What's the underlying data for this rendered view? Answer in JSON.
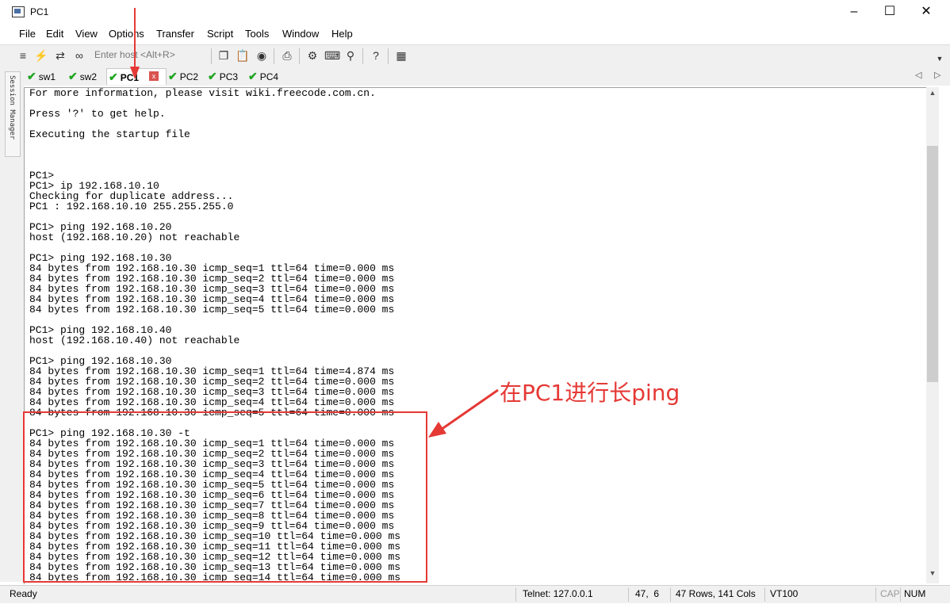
{
  "window": {
    "title": "PC1"
  },
  "menu": [
    "File",
    "Edit",
    "View",
    "Options",
    "Transfer",
    "Script",
    "Tools",
    "Window",
    "Help"
  ],
  "toolbar": {
    "host_placeholder": "Enter host <Alt+R>"
  },
  "tabs": [
    {
      "label": "sw1",
      "status": "connected"
    },
    {
      "label": "sw2",
      "status": "connected"
    },
    {
      "label": "PC1",
      "status": "connected",
      "active": true
    },
    {
      "label": "PC2",
      "status": "connected"
    },
    {
      "label": "PC3",
      "status": "connected"
    },
    {
      "label": "PC4",
      "status": "connected"
    }
  ],
  "tab_close_symbol": "x",
  "session_manager_label": "Session Manager",
  "terminal": {
    "lines": [
      "For more information, please visit wiki.freecode.com.cn.",
      "",
      "Press '?' to get help.",
      "",
      "Executing the startup file",
      "",
      "",
      "",
      "PC1>",
      "PC1> ip 192.168.10.10",
      "Checking for duplicate address...",
      "PC1 : 192.168.10.10 255.255.255.0",
      "",
      "PC1> ping 192.168.10.20",
      "host (192.168.10.20) not reachable",
      "",
      "PC1> ping 192.168.10.30",
      "84 bytes from 192.168.10.30 icmp_seq=1 ttl=64 time=0.000 ms",
      "84 bytes from 192.168.10.30 icmp_seq=2 ttl=64 time=0.000 ms",
      "84 bytes from 192.168.10.30 icmp_seq=3 ttl=64 time=0.000 ms",
      "84 bytes from 192.168.10.30 icmp_seq=4 ttl=64 time=0.000 ms",
      "84 bytes from 192.168.10.30 icmp_seq=5 ttl=64 time=0.000 ms",
      "",
      "PC1> ping 192.168.10.40",
      "host (192.168.10.40) not reachable",
      "",
      "PC1> ping 192.168.10.30",
      "84 bytes from 192.168.10.30 icmp_seq=1 ttl=64 time=4.874 ms",
      "84 bytes from 192.168.10.30 icmp_seq=2 ttl=64 time=0.000 ms",
      "84 bytes from 192.168.10.30 icmp_seq=3 ttl=64 time=0.000 ms",
      "84 bytes from 192.168.10.30 icmp_seq=4 ttl=64 time=0.000 ms",
      "84 bytes from 192.168.10.30 icmp_seq=5 ttl=64 time=0.000 ms",
      "",
      "PC1> ping 192.168.10.30 -t",
      "84 bytes from 192.168.10.30 icmp_seq=1 ttl=64 time=0.000 ms",
      "84 bytes from 192.168.10.30 icmp_seq=2 ttl=64 time=0.000 ms",
      "84 bytes from 192.168.10.30 icmp_seq=3 ttl=64 time=0.000 ms",
      "84 bytes from 192.168.10.30 icmp_seq=4 ttl=64 time=0.000 ms",
      "84 bytes from 192.168.10.30 icmp_seq=5 ttl=64 time=0.000 ms",
      "84 bytes from 192.168.10.30 icmp_seq=6 ttl=64 time=0.000 ms",
      "84 bytes from 192.168.10.30 icmp_seq=7 ttl=64 time=0.000 ms",
      "84 bytes from 192.168.10.30 icmp_seq=8 ttl=64 time=0.000 ms",
      "84 bytes from 192.168.10.30 icmp_seq=9 ttl=64 time=0.000 ms",
      "84 bytes from 192.168.10.30 icmp_seq=10 ttl=64 time=0.000 ms",
      "84 bytes from 192.168.10.30 icmp_seq=11 ttl=64 time=0.000 ms",
      "84 bytes from 192.168.10.30 icmp_seq=12 ttl=64 time=0.000 ms",
      "84 bytes from 192.168.10.30 icmp_seq=13 ttl=64 time=0.000 ms",
      "84 bytes from 192.168.10.30 icmp_seq=14 ttl=64 time=0.000 ms"
    ]
  },
  "annotation": {
    "text": "在PC1进行长ping",
    "color": "#e53935"
  },
  "statusbar": {
    "ready": "Ready",
    "connection": "Telnet: 127.0.0.1",
    "cursor": "47,  6",
    "size": "47 Rows, 141 Cols",
    "terminal_type": "VT100",
    "cap": "CAP",
    "num": "NUM"
  },
  "colors": {
    "accent_red": "#e53935",
    "check_green": "#1fa41f"
  }
}
